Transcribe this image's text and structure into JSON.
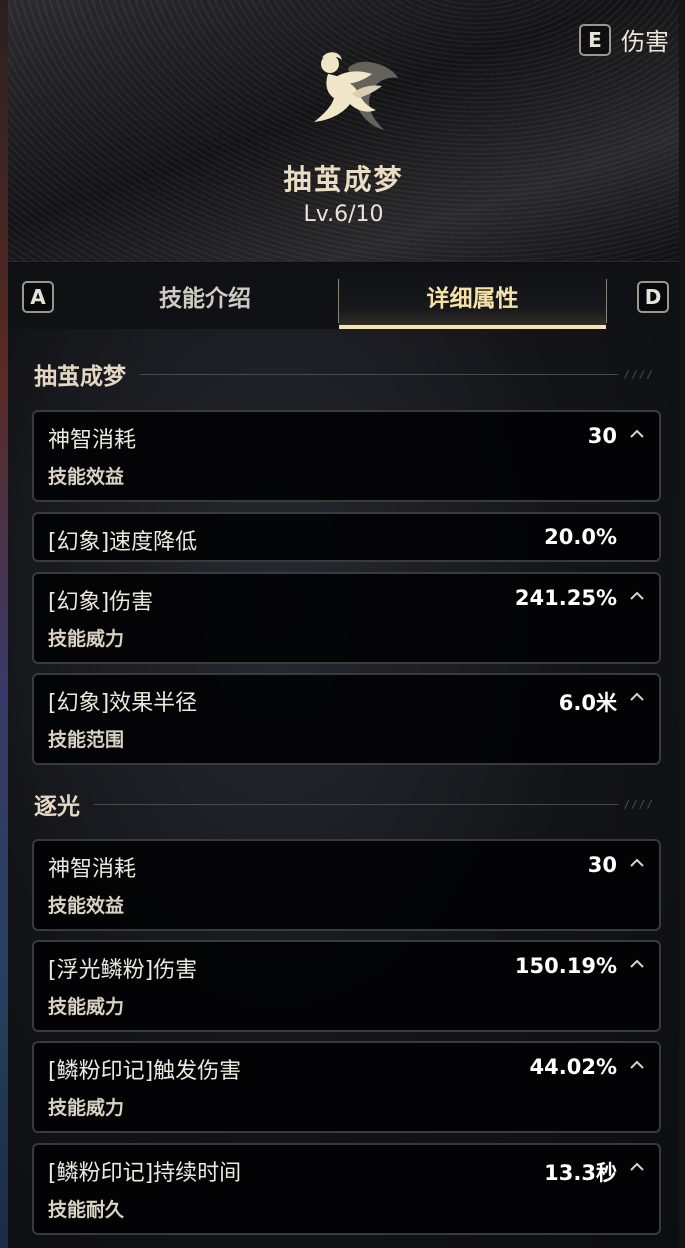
{
  "header": {
    "hotkey_key": "E",
    "hotkey_label": "伤害",
    "skill_name": "抽茧成梦",
    "level": "Lv.6/10"
  },
  "tabs": {
    "left_key": "A",
    "right_key": "D",
    "items": [
      {
        "label": "技能介绍",
        "active": false
      },
      {
        "label": "详细属性",
        "active": true
      }
    ]
  },
  "sections": [
    {
      "title": "抽茧成梦",
      "rows": [
        {
          "name": "神智消耗",
          "value": "30",
          "sub": "技能效益",
          "expanded": true
        },
        {
          "name": "[幻象]速度降低",
          "value": "20.0%",
          "sub": ""
        },
        {
          "name": "[幻象]伤害",
          "value": "241.25%",
          "sub": "技能威力",
          "expanded": true
        },
        {
          "name": "[幻象]效果半径",
          "value": "6.0米",
          "sub": "技能范围",
          "expanded": true
        }
      ]
    },
    {
      "title": "逐光",
      "rows": [
        {
          "name": "神智消耗",
          "value": "30",
          "sub": "技能效益",
          "expanded": true
        },
        {
          "name": "[浮光鳞粉]伤害",
          "value": "150.19%",
          "sub": "技能威力",
          "expanded": true
        },
        {
          "name": "[鳞粉印记]触发伤害",
          "value": "44.02%",
          "sub": "技能威力",
          "expanded": true
        },
        {
          "name": "[鳞粉印记]持续时间",
          "value": "13.3秒",
          "sub": "技能耐久",
          "expanded": true
        }
      ]
    }
  ],
  "colors": {
    "accent": "#f3e3b0",
    "title": "#e9ddc4",
    "row_border": "#3a3a3d"
  },
  "icons": {
    "skill": "flying-fairy-icon",
    "collapse": "chevron-up-icon"
  }
}
